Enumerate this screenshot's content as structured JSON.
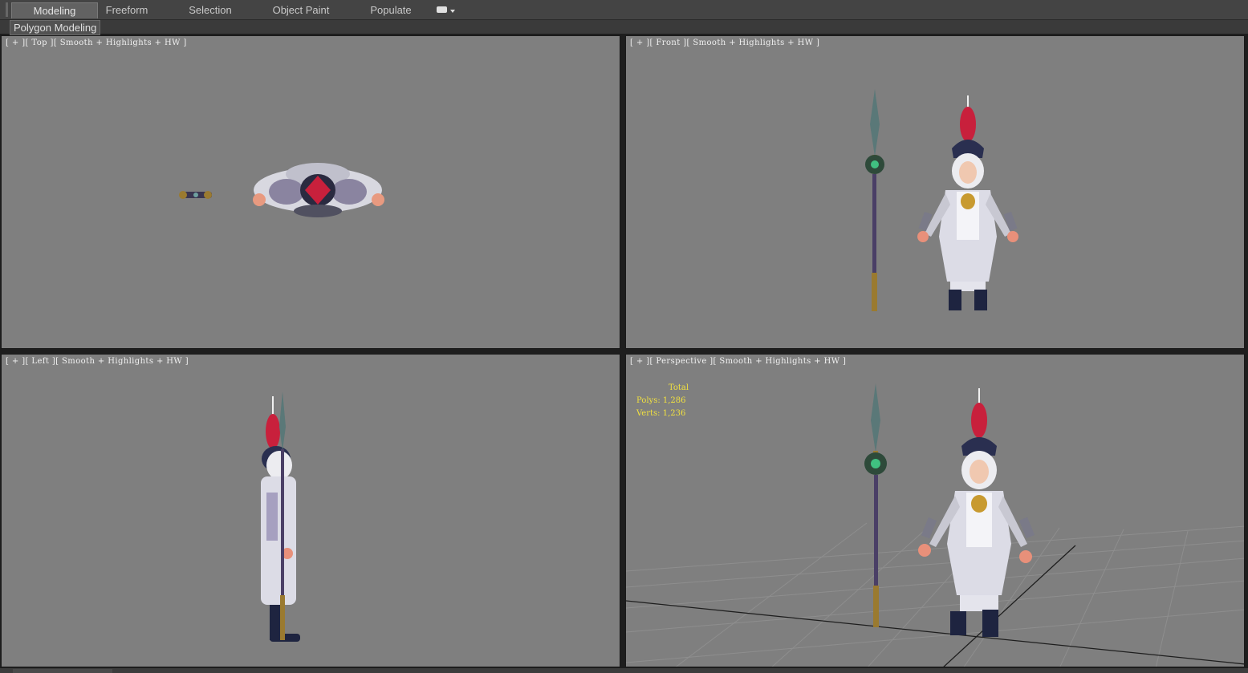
{
  "ribbon": {
    "tabs": [
      {
        "label": "Modeling",
        "active": true
      },
      {
        "label": "Freeform",
        "active": false
      },
      {
        "label": "Selection",
        "active": false
      },
      {
        "label": "Object Paint",
        "active": false
      },
      {
        "label": "Populate",
        "active": false
      }
    ],
    "menu_icon": "ribbon-options-icon"
  },
  "subbar": {
    "panel_label": "Polygon Modeling"
  },
  "viewports": {
    "top": {
      "label": "[ + ][ Top ][ Smooth + Highlights + HW ]"
    },
    "front": {
      "label": "[ + ][ Front ][ Smooth + Highlights + HW ]"
    },
    "left": {
      "label": "[ + ][ Left ][ Smooth + Highlights + HW ]"
    },
    "perspective": {
      "label": "[ + ][ Perspective ][ Smooth + Highlights + HW ]",
      "stats": {
        "title": "Total",
        "polys": "Polys: 1,286",
        "verts": "Verts: 1,236"
      }
    }
  },
  "colors": {
    "viewport_bg": "#7f7f7f",
    "stats_text": "#f0e040",
    "armor": "#e0e0e8",
    "plume": "#c8203c",
    "spear_shaft": "#4a3f66",
    "spear_gold": "#9a7a30"
  }
}
